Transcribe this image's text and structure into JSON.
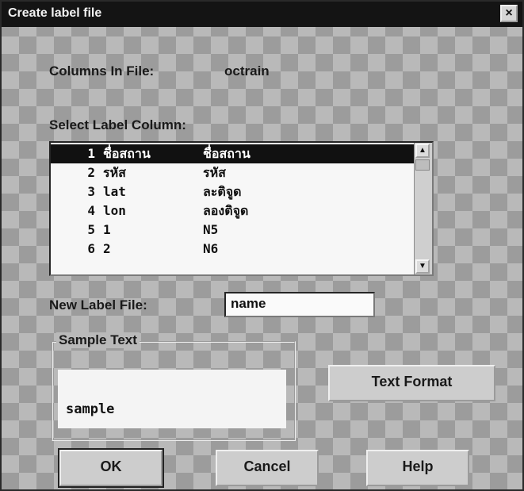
{
  "window": {
    "title": "Create label file",
    "close_glyph": "×"
  },
  "columns_in_file": {
    "label": "Columns In File:",
    "value": "octrain"
  },
  "select_label_column": {
    "label": "Select Label Column:",
    "rows": [
      {
        "num": "1",
        "name": "ชื่อสถาน",
        "alias": "ชื่อสถาน",
        "selected": true
      },
      {
        "num": "2",
        "name": "รหัส",
        "alias": "รหัส",
        "selected": false
      },
      {
        "num": "3",
        "name": "lat",
        "alias": "ละติจูด",
        "selected": false
      },
      {
        "num": "4",
        "name": "lon",
        "alias": "ลองติจูด",
        "selected": false
      },
      {
        "num": "5",
        "name": "1",
        "alias": "N5",
        "selected": false
      },
      {
        "num": "6",
        "name": "2",
        "alias": "N6",
        "selected": false
      }
    ],
    "scroll_up_icon": "▲",
    "scroll_down_icon": "▼"
  },
  "new_label_file": {
    "label": "New Label File:",
    "value": "name"
  },
  "sample_text": {
    "legend": "Sample Text",
    "preview": "sample"
  },
  "buttons": {
    "text_format": "Text Format",
    "ok": "OK",
    "cancel": "Cancel",
    "help": "Help"
  }
}
